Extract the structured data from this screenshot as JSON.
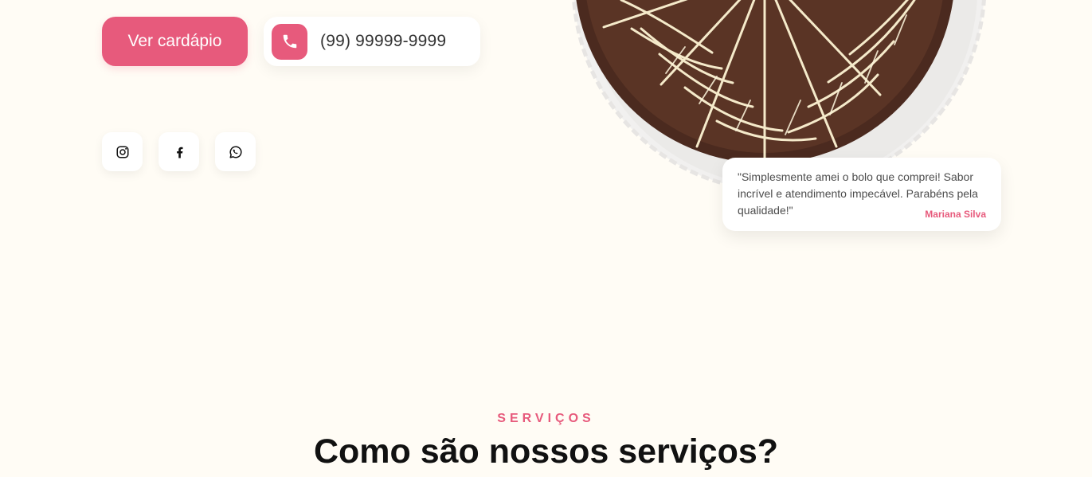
{
  "hero": {
    "menu_button_label": "Ver cardápio",
    "phone_number": "(99) 99999-9999",
    "phone_icon": "phone-icon",
    "social_icons": [
      "instagram-icon",
      "facebook-icon",
      "whatsapp-icon"
    ]
  },
  "testimonial": {
    "quote": "\"Simplesmente amei o bolo que comprei! Sabor incrível e atendimento impecável. Parabéns pela qualidade!\"",
    "author": "Mariana Silva"
  },
  "services": {
    "eyebrow": "SERVIÇOS",
    "heading": "Como são nossos serviços?"
  },
  "colors": {
    "background": "#fffcf5",
    "accent": "#e75a7c",
    "text_dark": "#111111"
  }
}
